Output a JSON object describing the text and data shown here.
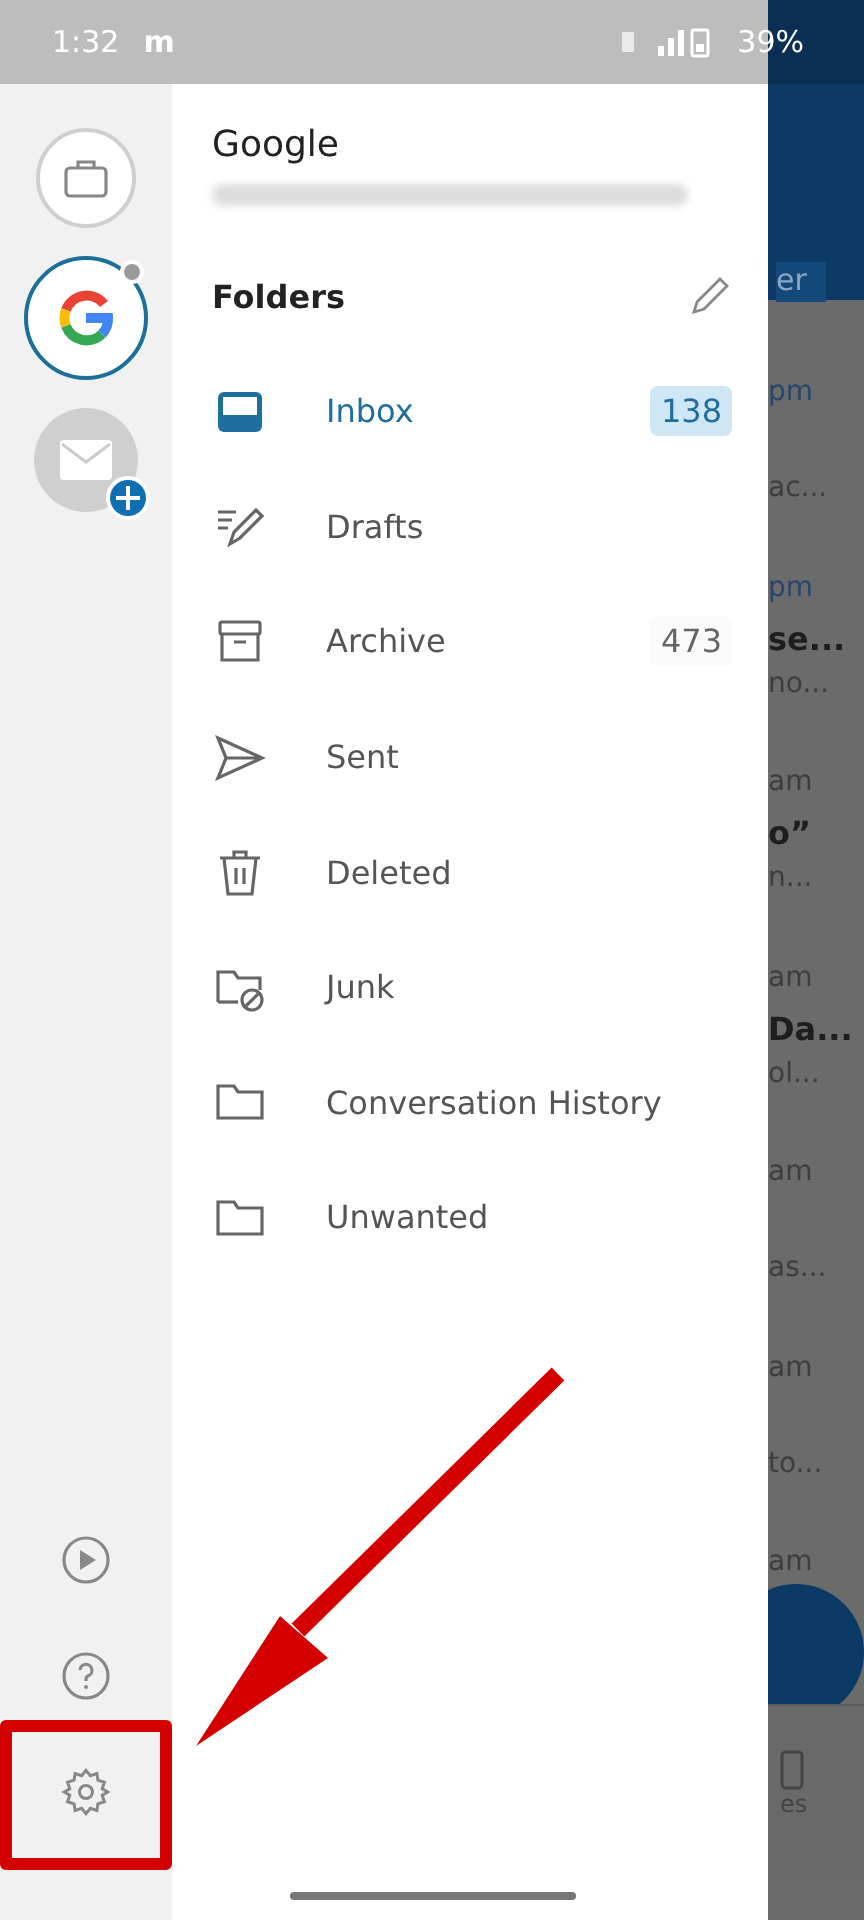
{
  "status_bar": {
    "time": "1:32",
    "app_letter": "m",
    "battery": "39%"
  },
  "account": {
    "name": "Google"
  },
  "rail": {
    "accounts": [
      {
        "kind": "briefcase",
        "selected": false
      },
      {
        "kind": "google",
        "selected": true
      },
      {
        "kind": "add-mail",
        "selected": false
      }
    ]
  },
  "folders": {
    "title": "Folders",
    "items": [
      {
        "kind": "inbox",
        "label": "Inbox",
        "count": "138",
        "selected": true
      },
      {
        "kind": "drafts",
        "label": "Drafts",
        "selected": false
      },
      {
        "kind": "archive",
        "label": "Archive",
        "count": "473",
        "selected": false
      },
      {
        "kind": "sent",
        "label": "Sent",
        "selected": false
      },
      {
        "kind": "deleted",
        "label": "Deleted",
        "selected": false
      },
      {
        "kind": "junk",
        "label": "Junk",
        "selected": false
      },
      {
        "kind": "folder",
        "label": "Conversation History",
        "selected": false
      },
      {
        "kind": "folder",
        "label": "Unwanted",
        "selected": false
      }
    ]
  },
  "background": {
    "header_button": "er",
    "emails": [
      {
        "time": "pm",
        "preview": "ac..."
      },
      {
        "time": "pm",
        "subject": "se...",
        "preview": "no..."
      },
      {
        "time": "am",
        "subject": "o”",
        "preview": "n..."
      },
      {
        "time": "am",
        "subject": "Da...",
        "preview": "ol..."
      },
      {
        "time": "am",
        "preview": "as..."
      },
      {
        "time": "am",
        "preview": "to..."
      },
      {
        "time": "am"
      }
    ],
    "nav_label": "es"
  }
}
